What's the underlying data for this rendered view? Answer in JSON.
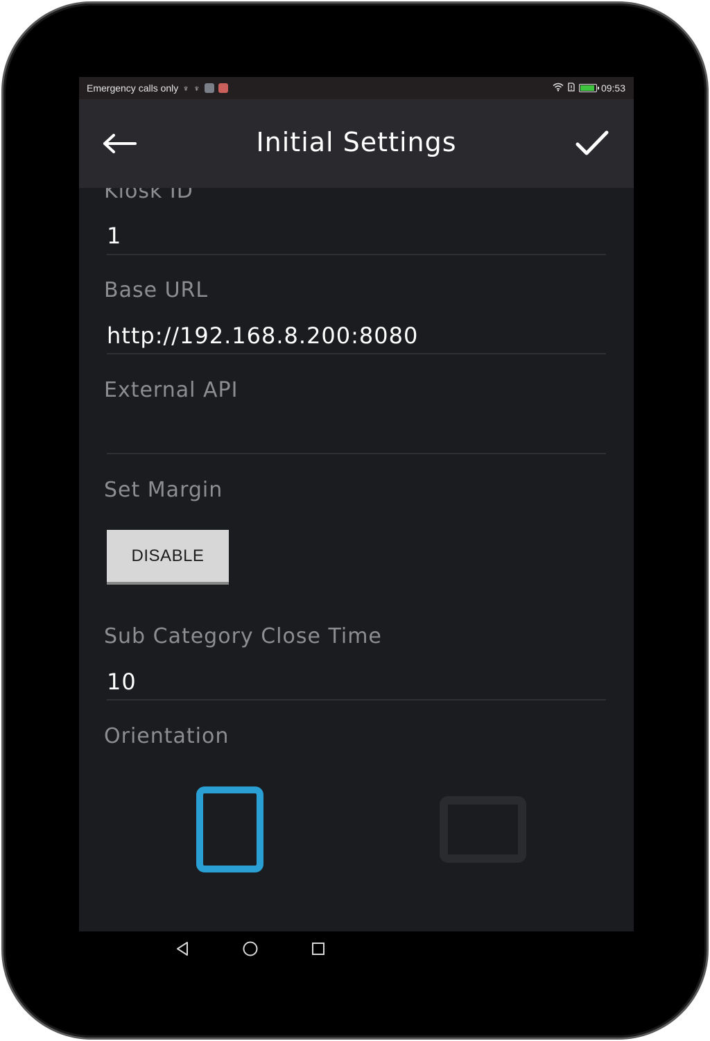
{
  "status_bar": {
    "carrier_text": "Emergency calls only",
    "time": "09:53",
    "icons": [
      "usb-icon",
      "usb-icon",
      "app-notification-icon",
      "app-notification-icon",
      "wifi-icon",
      "sim-icon",
      "battery-icon"
    ],
    "battery_level": 0.9,
    "battery_color": "#3ec43e"
  },
  "app_bar": {
    "title": "Initial Settings",
    "back_icon": "arrow-back-icon",
    "confirm_icon": "check-icon"
  },
  "fields": {
    "kiosk_id": {
      "label": "Kiosk ID",
      "value": "1"
    },
    "base_url": {
      "label": "Base URL",
      "value": "http://192.168.8.200:8080"
    },
    "external_api": {
      "label": "External API",
      "value": ""
    },
    "set_margin": {
      "label": "Set Margin",
      "button": "DISABLE"
    },
    "sub_category_close_time": {
      "label": "Sub Category Close Time",
      "value": "10"
    },
    "orientation": {
      "label": "Orientation",
      "selected": "portrait"
    }
  },
  "colors": {
    "accent": "#2a9fd3",
    "background": "#1b1c20",
    "app_bar": "#2a292e",
    "label": "#8d8e92"
  },
  "nav_bar": {
    "icons": [
      "back-triangle-icon",
      "home-circle-icon",
      "recents-square-icon"
    ]
  }
}
